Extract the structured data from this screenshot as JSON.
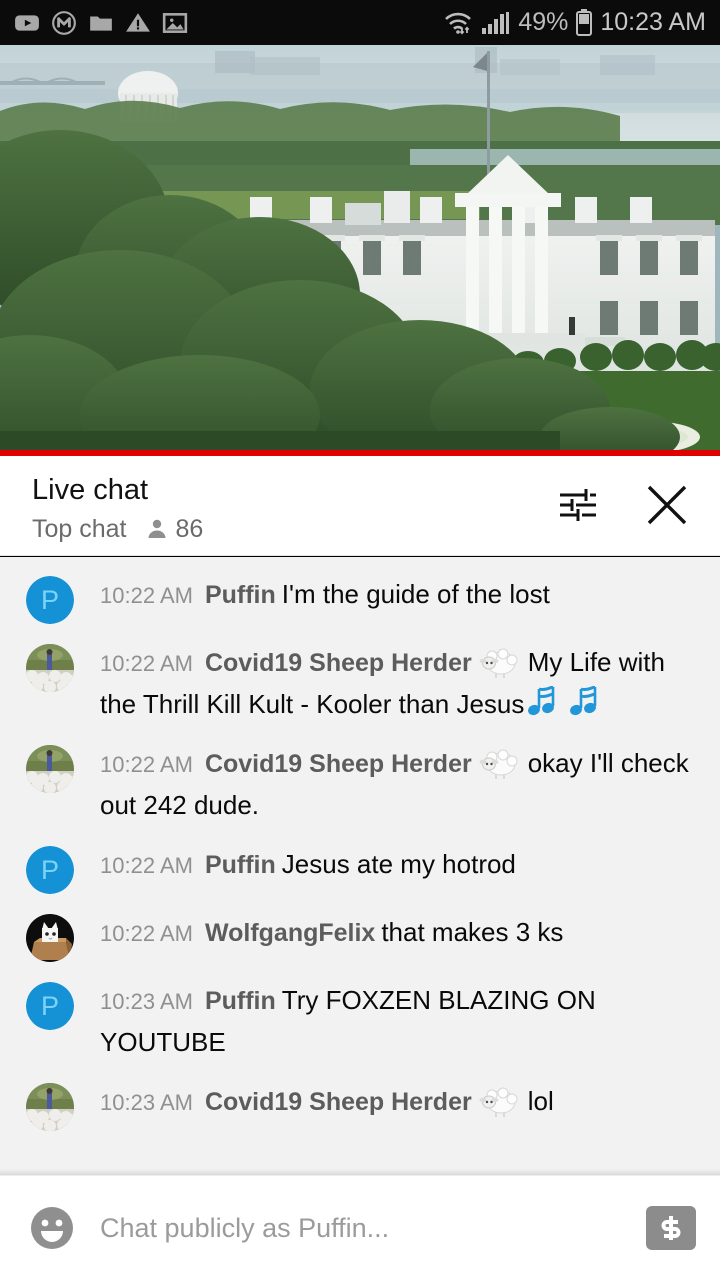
{
  "status_bar": {
    "left_icons": [
      "youtube-icon",
      "gmail-m-icon",
      "folder-icon",
      "warning-triangle-icon",
      "photo-icon"
    ],
    "wifi_icon": "wifi-icon",
    "signal_icon": "cell-signal-icon",
    "battery_percent": "49%",
    "battery_icon": "battery-icon",
    "clock": "10:23 AM",
    "background": "#0b0b0b",
    "foreground": "#b3b3b3"
  },
  "video": {
    "description": "White House exterior with Jefferson Memorial dome and Potomac in the distance",
    "progress_color": "#e00000",
    "progress_percent": 100
  },
  "chat_header": {
    "title": "Live chat",
    "subtitle": "Top chat",
    "viewer_icon": "person-icon",
    "viewer_count": "86",
    "settings_icon": "sliders-settings-icon",
    "close_icon": "close-icon"
  },
  "messages": [
    {
      "time": "10:22 AM",
      "author": "Puffin",
      "avatar_type": "initial",
      "avatar_initial": "P",
      "avatar_bg": "#1592d6",
      "avatar_fg": "#7dd2f7",
      "text": "I'm the guide of the lost",
      "emoji_after_name": null,
      "emoji_after_text": null
    },
    {
      "time": "10:22 AM",
      "author": "Covid19 Sheep Herder",
      "avatar_type": "sheep-photo",
      "text": "My Life with the Thrill Kill Kult - Kooler than Jesus",
      "emoji_after_name": "sheep-emoji",
      "emoji_after_text": "musical-notes-emoji musical-notes-emoji"
    },
    {
      "time": "10:22 AM",
      "author": "Covid19 Sheep Herder",
      "avatar_type": "sheep-photo",
      "text": "okay I'll check out 242 dude.",
      "emoji_after_name": "sheep-emoji",
      "emoji_after_text": null
    },
    {
      "time": "10:22 AM",
      "author": "Puffin",
      "avatar_type": "initial",
      "avatar_initial": "P",
      "avatar_bg": "#1592d6",
      "avatar_fg": "#7dd2f7",
      "text": "Jesus ate my hotrod",
      "emoji_after_name": null,
      "emoji_after_text": null
    },
    {
      "time": "10:22 AM",
      "author": "WolfgangFelix",
      "avatar_type": "cat-box-photo",
      "text": "that makes 3 ks",
      "emoji_after_name": null,
      "emoji_after_text": null
    },
    {
      "time": "10:23 AM",
      "author": "Puffin",
      "avatar_type": "initial",
      "avatar_initial": "P",
      "avatar_bg": "#1592d6",
      "avatar_fg": "#7dd2f7",
      "text": "Try FOXZEN BLAZING ON YOUTUBE",
      "emoji_after_name": null,
      "emoji_after_text": null
    },
    {
      "time": "10:23 AM",
      "author": "Covid19 Sheep Herder",
      "avatar_type": "sheep-photo",
      "text": "lol",
      "emoji_after_name": "sheep-emoji",
      "emoji_after_text": null
    }
  ],
  "input_bar": {
    "emoji_icon": "emoji-smiley-icon",
    "placeholder": "Chat publicly as Puffin...",
    "value": "",
    "superchat_icon": "dollar-superchat-icon"
  },
  "colors": {
    "chat_bg": "#f2f2f2",
    "header_bg": "#ffffff",
    "accent_red": "#e00000"
  }
}
